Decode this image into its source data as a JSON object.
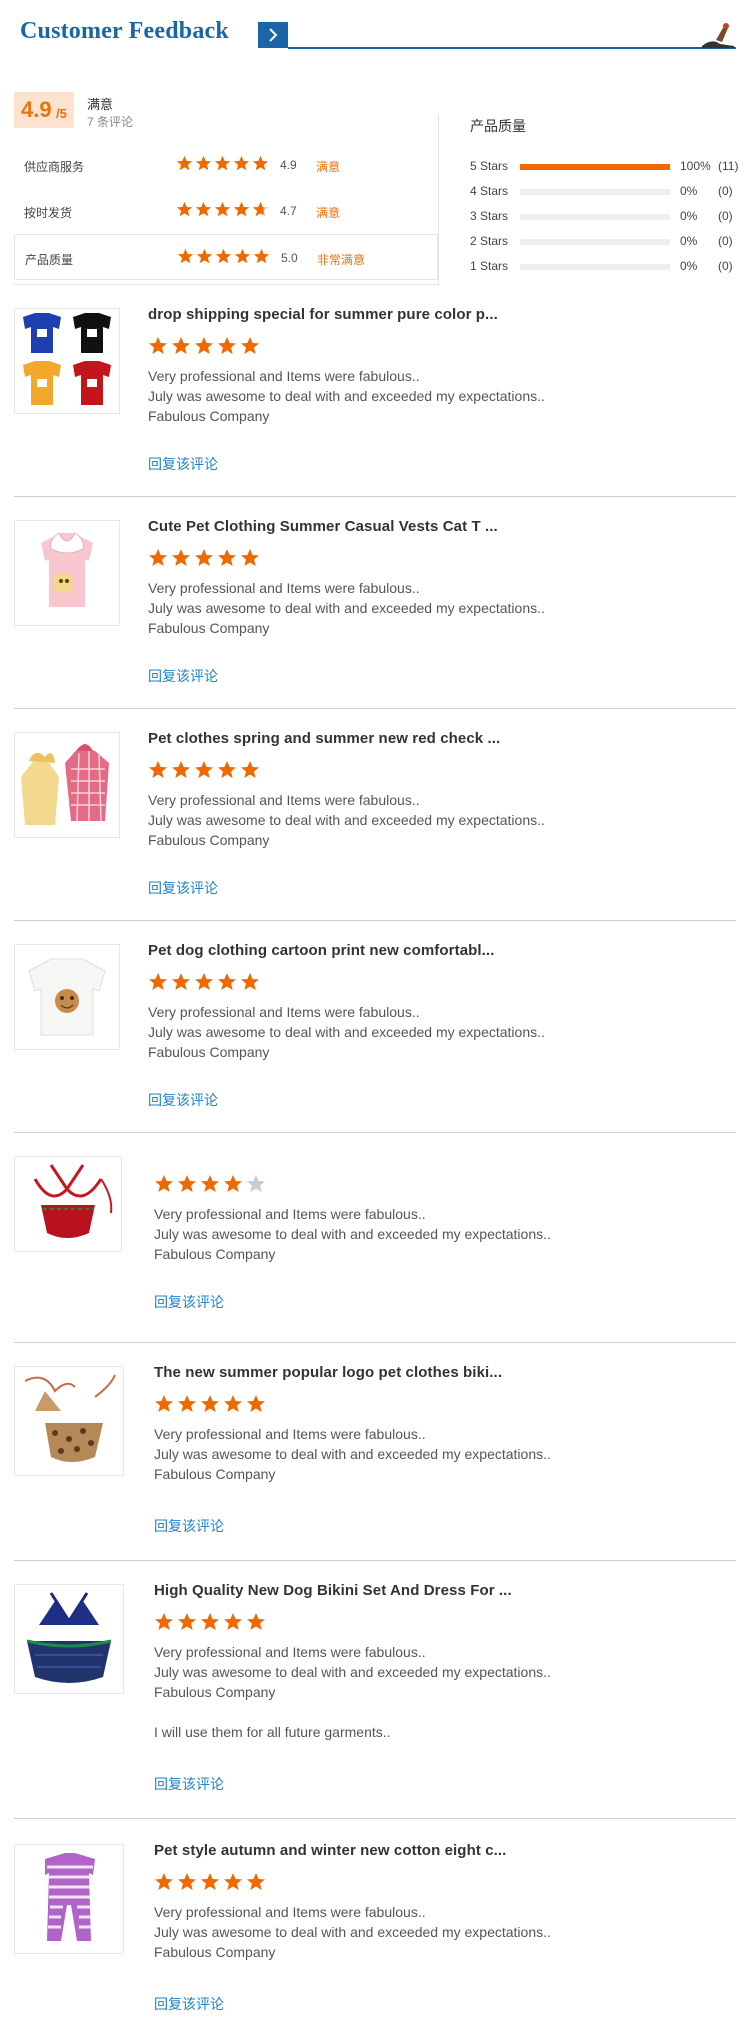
{
  "header": {
    "title": "Customer Feedback",
    "icon_next": "chevron-right-icon",
    "brand_color": "#1a64a8"
  },
  "summary": {
    "score": "4.9",
    "score_suffix": "/5",
    "label": "满意",
    "count": "7 条评论",
    "ratings": [
      {
        "label": "供应商服务",
        "stars": 5,
        "value": "4.9",
        "word": "满意"
      },
      {
        "label": "按时发货",
        "stars": 4.7,
        "value": "4.7",
        "word": "满意"
      },
      {
        "label": "产品质量",
        "stars": 5,
        "value": "5.0",
        "word": "非常满意"
      }
    ],
    "distribution_title": "产品质量",
    "distribution": [
      {
        "label": "5 Stars",
        "fraction": 1.0,
        "pct": "100%",
        "count": "(11)"
      },
      {
        "label": "4 Stars",
        "fraction": 0,
        "pct": "0%",
        "count": "(0)"
      },
      {
        "label": "3 Stars",
        "fraction": 0,
        "pct": "0%",
        "count": "(0)"
      },
      {
        "label": "2 Stars",
        "fraction": 0,
        "pct": "0%",
        "count": "(0)"
      },
      {
        "label": "1 Stars",
        "fraction": 0,
        "pct": "0%",
        "count": "(0)"
      }
    ],
    "star_color": "#ee6a00",
    "accent_color": "#e8730f"
  },
  "reviews": [
    {
      "title": "drop shipping special for summer pure color p...",
      "stars": 5,
      "lines": [
        "Very professional and Items were fabulous..",
        "July was awesome to deal with and exceeded my expectations..",
        "Fabulous Company"
      ],
      "extra": "",
      "reply": "回复该评论",
      "image": "pet-shirts-image"
    },
    {
      "title": "Cute Pet Clothing Summer Casual Vests Cat T ...",
      "stars": 5,
      "lines": [
        "Very professional and Items were fabulous..",
        "July was awesome to deal with and exceeded my expectations..",
        "Fabulous Company"
      ],
      "extra": "",
      "reply": "回复该评论",
      "image": "pink-vest-image"
    },
    {
      "title": "Pet clothes spring and summer new red check ...",
      "stars": 5,
      "lines": [
        "Very professional and Items were fabulous..",
        "July was awesome to deal with and exceeded my expectations..",
        "Fabulous Company"
      ],
      "extra": "",
      "reply": "回复该评论",
      "image": "check-dress-image"
    },
    {
      "title": "Pet dog clothing cartoon print new comfortabl...",
      "stars": 5,
      "lines": [
        "Very professional and Items were fabulous..",
        "July was awesome to deal with and exceeded my expectations..",
        "Fabulous Company"
      ],
      "extra": "",
      "reply": "回复该评论",
      "image": "white-shirt-image"
    },
    {
      "title": "",
      "stars": 4,
      "lines": [
        "Very professional and Items were fabulous..",
        "July was awesome to deal with and exceeded my expectations..",
        "Fabulous Company"
      ],
      "extra": "",
      "reply": "回复该评论",
      "image": "red-bikini-image"
    },
    {
      "title": "The new summer popular logo pet clothes biki...",
      "stars": 5,
      "lines": [
        "Very professional and Items were fabulous..",
        "July was awesome to deal with and exceeded my expectations..",
        "Fabulous Company"
      ],
      "extra": "",
      "reply": "回复该评论",
      "image": "leopard-bikini-image"
    },
    {
      "title": "High Quality New Dog Bikini Set And Dress For ...",
      "stars": 5,
      "lines": [
        "Very professional and Items were fabulous..",
        "July was awesome to deal with and exceeded my expectations..",
        "Fabulous Company"
      ],
      "extra": "I will use them for all future garments..",
      "reply": "回复该评论",
      "image": "navy-bikini-image"
    },
    {
      "title": "Pet style autumn and winter new cotton eight c...",
      "stars": 5,
      "lines": [
        "Very professional and Items were fabulous..",
        "July was awesome to deal with and exceeded my expectations..",
        "Fabulous Company"
      ],
      "extra": "",
      "reply": "回复该评论",
      "image": "striped-jumpsuit-image"
    }
  ]
}
